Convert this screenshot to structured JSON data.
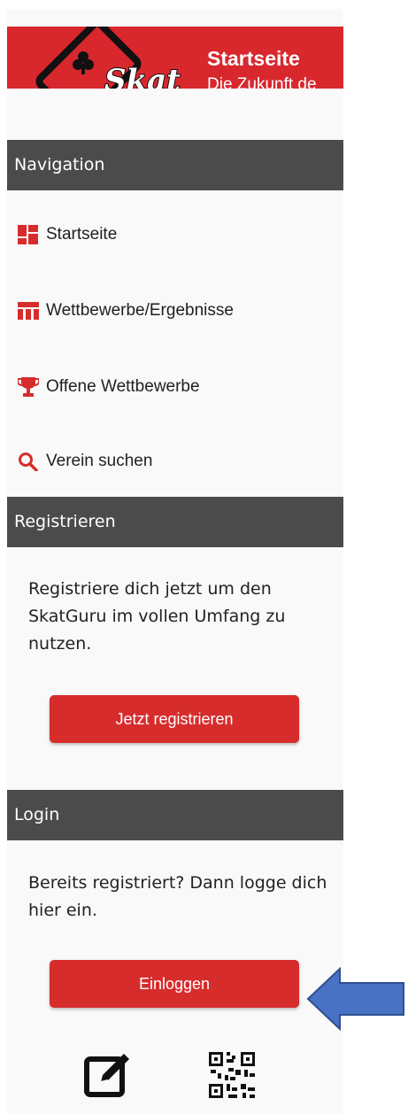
{
  "header": {
    "title": "Startseite",
    "subtitle": "Die Zukunft de",
    "logo_text": "Skat Guru",
    "brand_color": "#d9272e"
  },
  "navigation": {
    "heading": "Navigation",
    "items": [
      {
        "label": "Startseite",
        "icon": "dashboard-icon"
      },
      {
        "label": "Wettbewerbe/Ergebnisse",
        "icon": "table-icon"
      },
      {
        "label": "Offene Wettbewerbe",
        "icon": "trophy-icon"
      },
      {
        "label": "Verein suchen",
        "icon": "search-icon"
      }
    ]
  },
  "register": {
    "heading": "Registrieren",
    "text": "Registriere dich jetzt um den SkatGuru im vollen Umfang zu nutzen.",
    "button_label": "Jetzt registrieren"
  },
  "login": {
    "heading": "Login",
    "text": "Bereits registriert? Dann logge dich hier ein.",
    "button_label": "Einloggen"
  },
  "bottom_icons": [
    "edit-icon",
    "qr-code-icon"
  ],
  "colors": {
    "accent": "#d72c2c",
    "section_bar": "#4b4b4b",
    "panel_bg": "#f9f9f9",
    "arrow": "#4a72c4"
  }
}
